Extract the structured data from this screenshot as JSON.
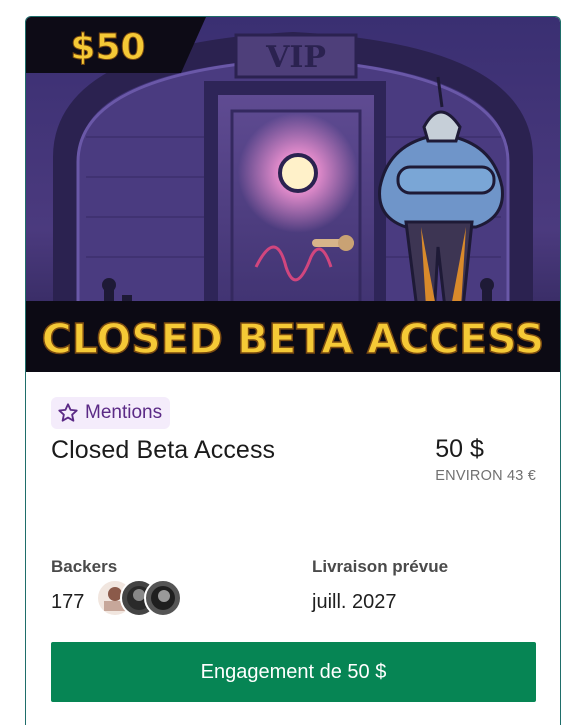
{
  "reward": {
    "image_price_badge": "$50",
    "image_vip_sign": "VIP",
    "image_banner": "CLOSED BETA ACCESS",
    "chip_label": "Mentions",
    "chip_icon": "star-outline-icon",
    "title": "Closed Beta Access",
    "price": "50 $",
    "price_approx": "ENVIRON 43 €",
    "backers_label": "Backers",
    "backers_count": "177",
    "delivery_label": "Livraison prévue",
    "delivery_date": "juill. 2027",
    "cta_label": "Engagement de 50 $"
  },
  "colors": {
    "border": "#1f6e6a",
    "chip_bg": "#f4ecfb",
    "chip_text": "#5b2a86",
    "cta_bg": "#068554",
    "banner_text": "#f5c936"
  }
}
